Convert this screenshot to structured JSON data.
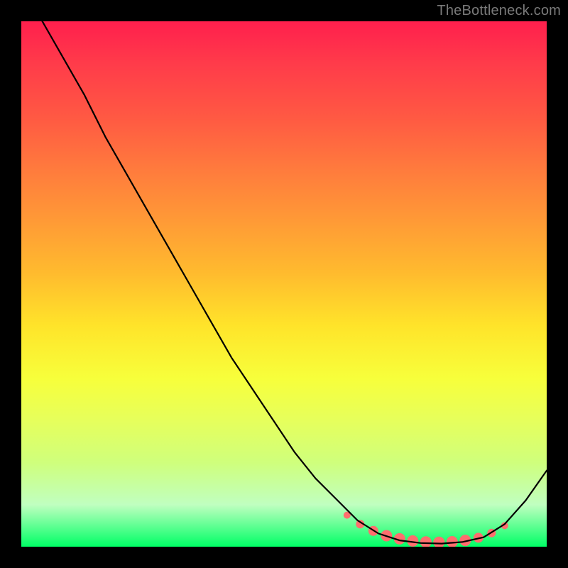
{
  "watermark": "TheBottleneck.com",
  "chart_data": {
    "type": "line",
    "title": "",
    "xlabel": "",
    "ylabel": "",
    "xlim": [
      0,
      100
    ],
    "ylim": [
      0,
      100
    ],
    "grid": false,
    "series": [
      {
        "name": "curve",
        "x": [
          0,
          4,
          8,
          12,
          16,
          20,
          24,
          28,
          32,
          36,
          40,
          44,
          48,
          52,
          56,
          60,
          64,
          68,
          72,
          76,
          80,
          84,
          88,
          92,
          96,
          100
        ],
        "values": [
          108,
          100,
          93,
          86,
          78,
          71,
          64,
          57,
          50,
          43,
          36,
          30,
          24,
          18,
          13,
          9,
          5,
          2.5,
          1.2,
          0.7,
          0.6,
          0.9,
          1.8,
          4.3,
          8.8,
          14.5
        ]
      }
    ],
    "marker_band": {
      "name": "optimal-range",
      "color": "#ff6e6e",
      "x": [
        62,
        64.5,
        67,
        69.5,
        72,
        74.5,
        77,
        79.5,
        82,
        84.5,
        87,
        89.5,
        92
      ],
      "values": [
        6.0,
        4.3,
        3.0,
        2.1,
        1.5,
        1.1,
        0.9,
        0.85,
        0.95,
        1.2,
        1.7,
        2.6,
        4.0
      ],
      "radii": [
        5,
        6,
        7,
        8,
        8,
        8,
        8,
        8,
        8,
        8,
        7,
        6,
        5
      ]
    }
  }
}
